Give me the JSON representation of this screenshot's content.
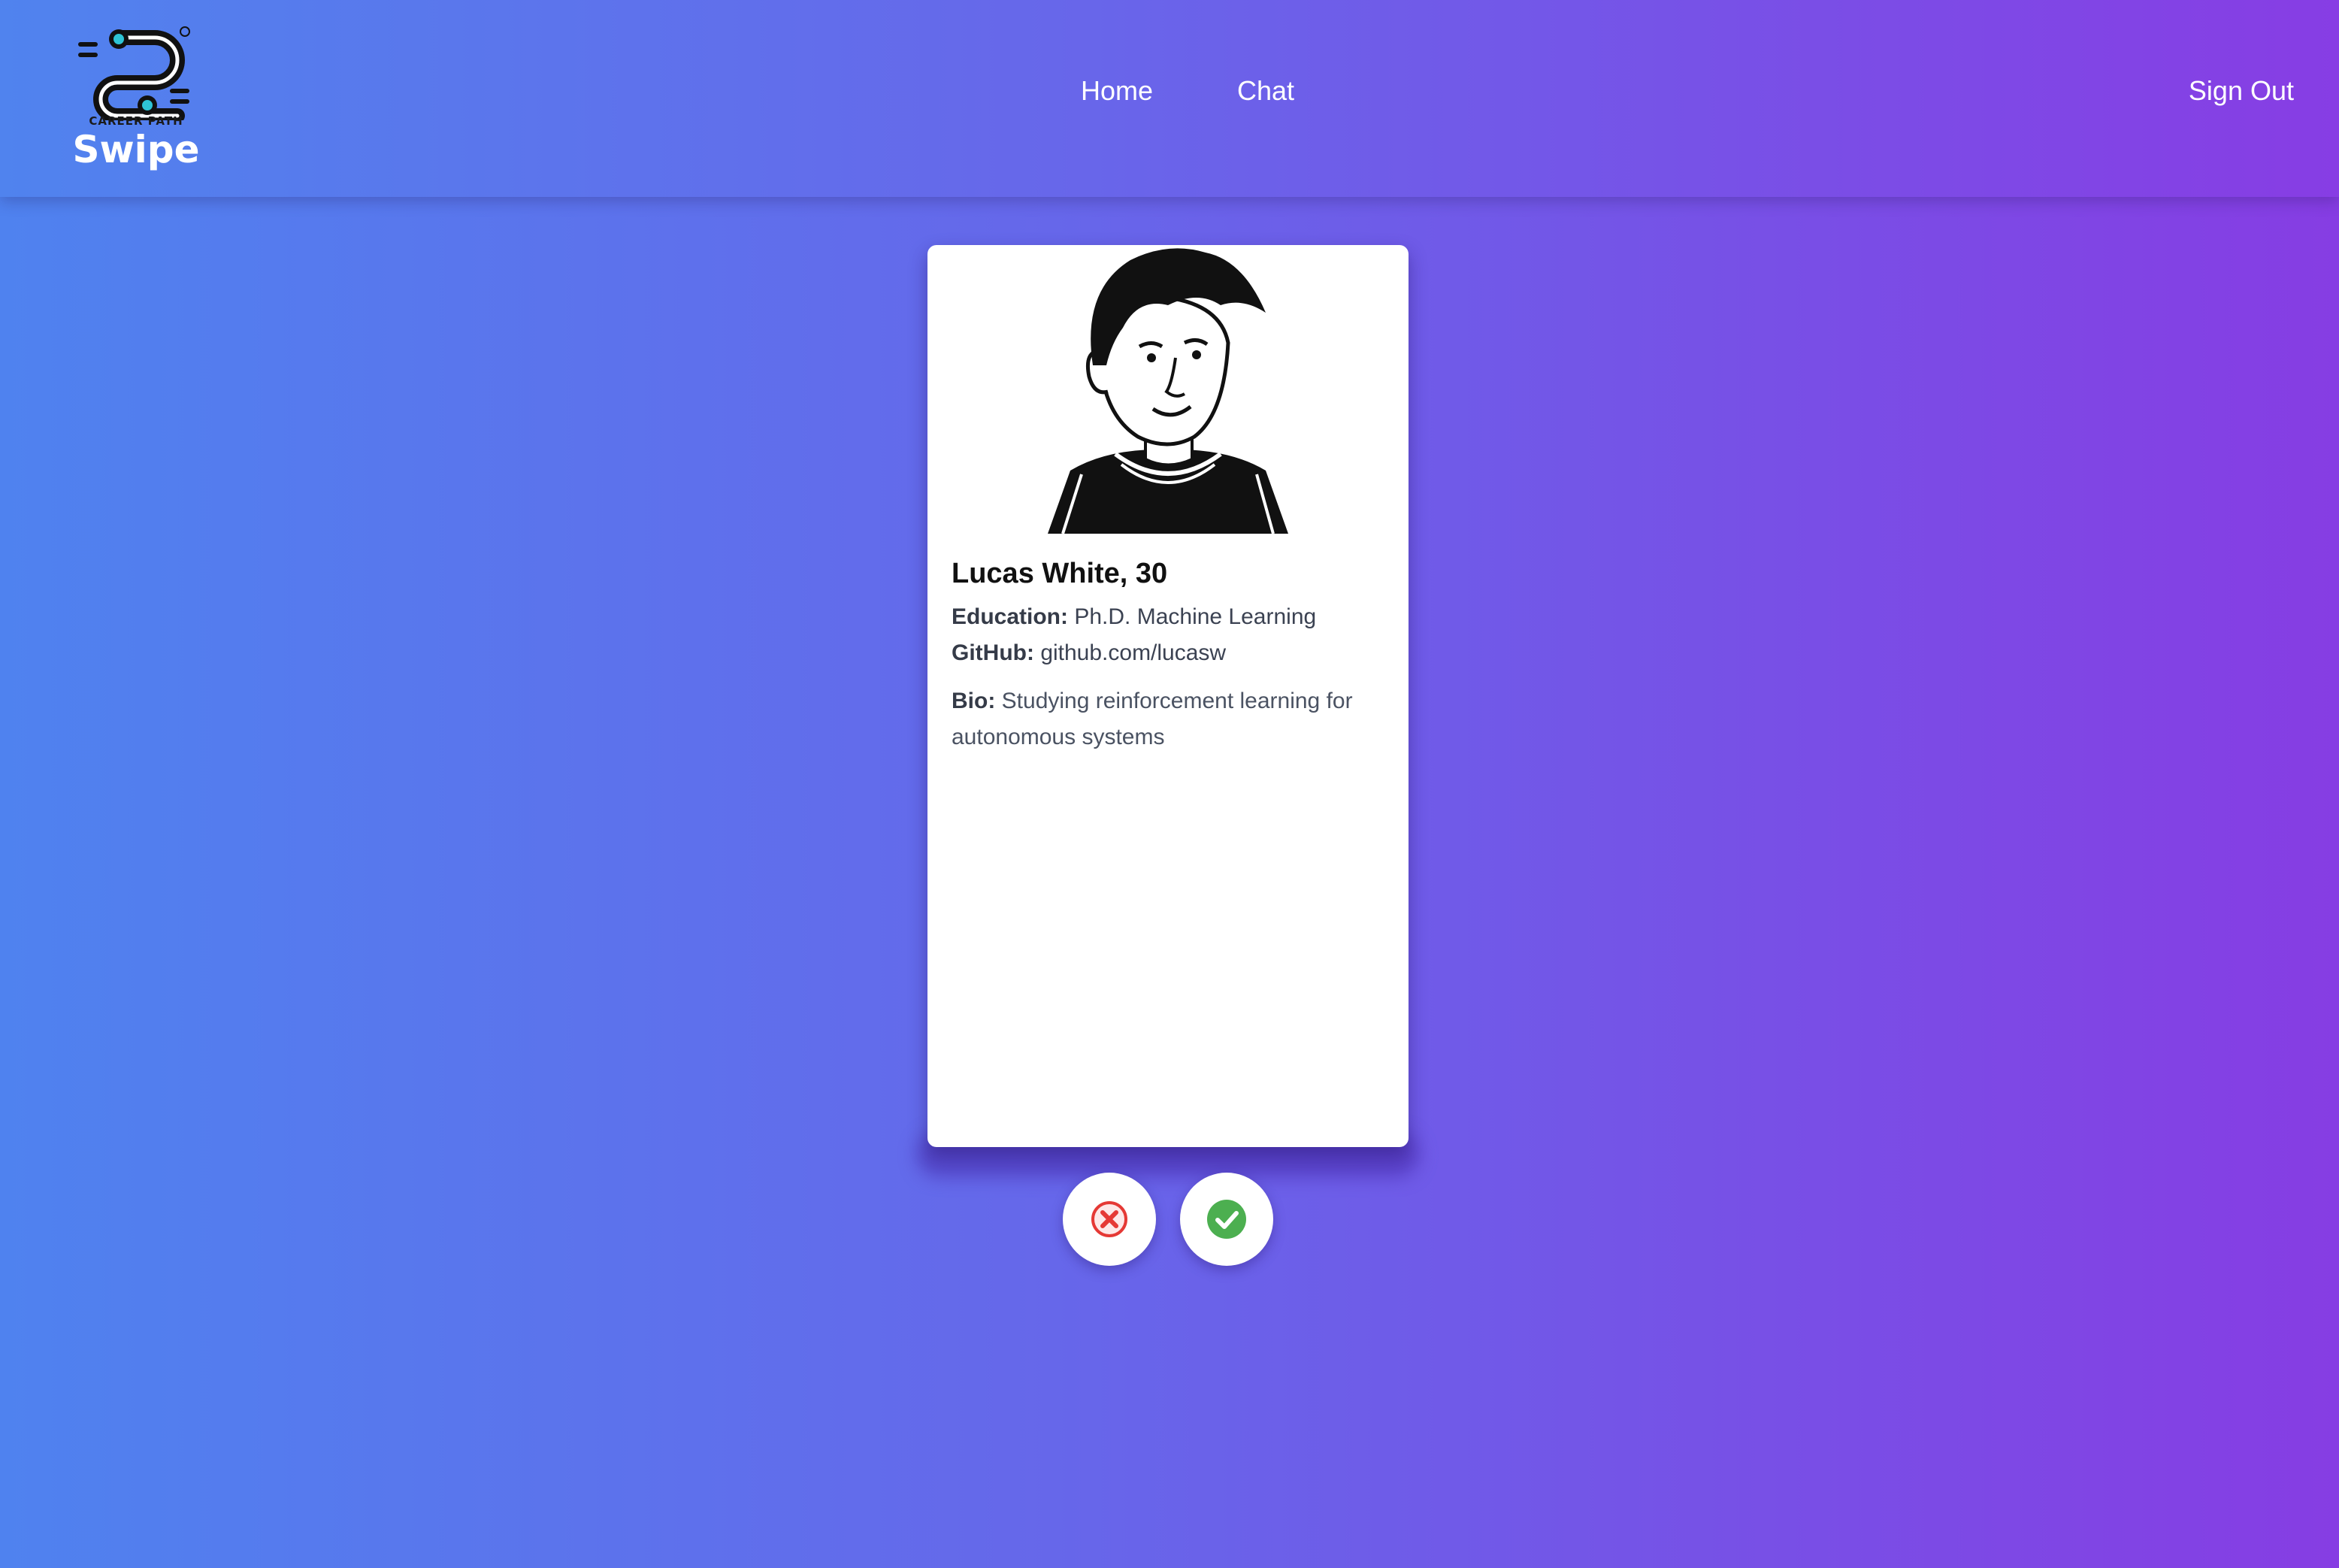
{
  "brand": {
    "tagline": "CAREER PATH",
    "name": "Swipe"
  },
  "nav": {
    "home": "Home",
    "chat": "Chat",
    "sign_out": "Sign Out"
  },
  "profile": {
    "name_age": "Lucas White, 30",
    "education_label": "Education:",
    "education": "Ph.D. Machine Learning",
    "github_label": "GitHub:",
    "github": "github.com/lucasw",
    "bio_label": "Bio:",
    "bio": "Studying reinforcement learning for autonomous systems"
  },
  "actions": {
    "reject_icon": "x-circle-icon",
    "accept_icon": "check-circle-icon"
  },
  "colors": {
    "reject": "#e53935",
    "accept": "#4caf50",
    "gradient_start": "#4f82ef",
    "gradient_end": "#863de3"
  }
}
